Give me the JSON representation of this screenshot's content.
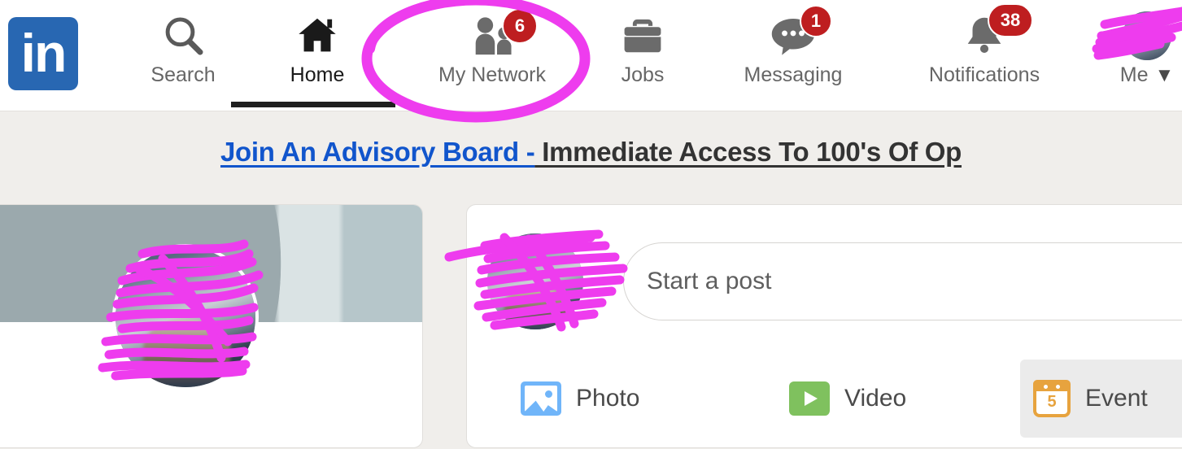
{
  "app": {
    "name": "LinkedIn",
    "logo_text": "in",
    "brand_color": "#2867B2",
    "badge_color": "#BE1E20",
    "annotation_color": "#EE3CEE",
    "page_background": "#F0EEEB"
  },
  "header": {
    "nav_items": [
      {
        "label": "Search",
        "icon": "search-icon",
        "badge": null,
        "active": false,
        "circled": false
      },
      {
        "label": "Home",
        "icon": "home-icon",
        "badge": null,
        "active": true,
        "circled": false
      },
      {
        "label": "My Network",
        "icon": "people-icon",
        "badge": "6",
        "active": false,
        "circled": true
      },
      {
        "label": "Jobs",
        "icon": "briefcase-icon",
        "badge": null,
        "active": false,
        "circled": false
      },
      {
        "label": "Messaging",
        "icon": "chat-bubble-icon",
        "badge": "1",
        "active": false,
        "circled": false
      },
      {
        "label": "Notifications",
        "icon": "bell-icon",
        "badge": "38",
        "active": false,
        "circled": false
      },
      {
        "label": "Me",
        "icon": "avatar-icon",
        "badge": null,
        "active": false,
        "circled": false
      }
    ],
    "me_caret": "▼"
  },
  "banner": {
    "link_text": "Join An Advisory Board -",
    "rest_text": " Immediate Access To 100's Of Op"
  },
  "profile_card": {
    "cover_colors": [
      "#9BA9AD",
      "#DAE3E4",
      "#B6C6CA"
    ],
    "avatar_alt": "profile-photo-redacted"
  },
  "composer": {
    "avatar_alt": "profile-photo-redacted",
    "post_placeholder": "Start a post",
    "actions": [
      {
        "label": "Photo",
        "icon": "photo-icon",
        "color": "#70B5F9",
        "hovered": false
      },
      {
        "label": "Video",
        "icon": "video-icon",
        "color": "#7FC15E",
        "hovered": false
      },
      {
        "label": "Event",
        "icon": "calendar-icon",
        "color": "#E7A33E",
        "hovered": true,
        "day_number": "5"
      }
    ]
  }
}
